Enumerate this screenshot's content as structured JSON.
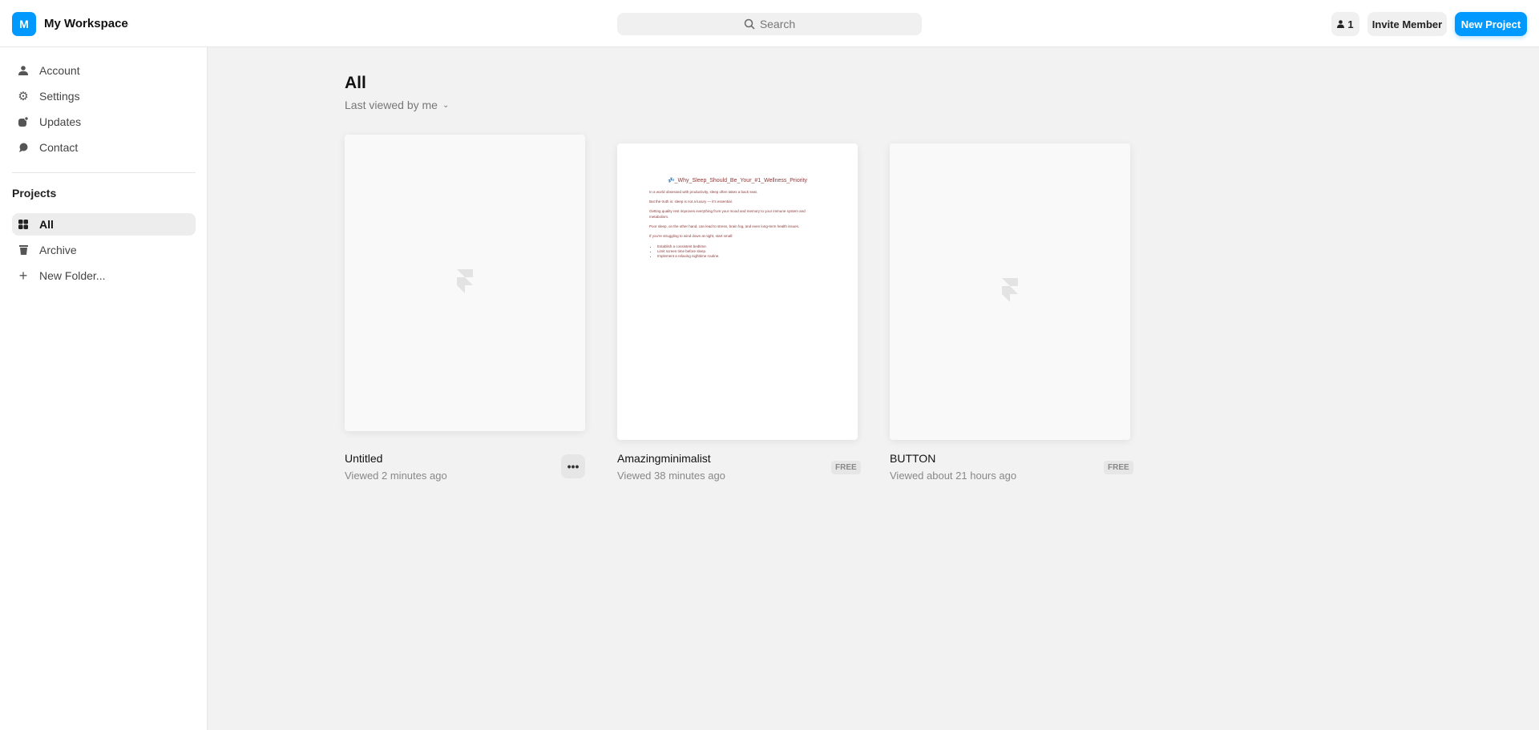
{
  "header": {
    "workspace_initial": "M",
    "workspace_name": "My Workspace",
    "search_placeholder": "Search",
    "member_count": "1",
    "invite_label": "Invite Member",
    "new_project_label": "New Project",
    "accent": "#0099ff"
  },
  "sidebar": {
    "items": [
      {
        "label": "Account",
        "icon": "user-icon"
      },
      {
        "label": "Settings",
        "icon": "gear-icon"
      },
      {
        "label": "Updates",
        "icon": "updates-icon"
      },
      {
        "label": "Contact",
        "icon": "chat-icon"
      }
    ],
    "projects_heading": "Projects",
    "projects": [
      {
        "label": "All",
        "icon": "grid-icon",
        "active": true
      },
      {
        "label": "Archive",
        "icon": "trash-icon"
      },
      {
        "label": "New Folder...",
        "icon": "plus-icon"
      }
    ]
  },
  "main": {
    "title": "All",
    "sort_label": "Last viewed by me",
    "cards": [
      {
        "title": "Untitled",
        "subtitle": "Viewed 2 minutes ago",
        "more": "•••"
      },
      {
        "title": "Amazingminimalist",
        "subtitle": "Viewed 38 minutes ago",
        "badge": "FREE",
        "preview": {
          "heading": "💤_Why_Sleep_Should_Be_Your_#1_Wellness_Priority",
          "paragraphs": [
            "In a world obsessed with productivity, sleep often takes a back seat.",
            "But the truth is: sleep is not a luxury — it's essential.",
            "Getting quality rest improves everything from your mood and memory to your immune system and metabolism.",
            "Poor sleep, on the other hand, can lead to stress, brain fog, and even long-term health issues.",
            "If you're struggling to wind down at night, start small:"
          ],
          "bullets": [
            "Establish a consistent bedtime.",
            "Limit screen time before sleep.",
            "Implement a relaxing nighttime routine."
          ]
        }
      },
      {
        "title": "BUTTON",
        "subtitle": "Viewed about 21 hours ago",
        "badge": "FREE"
      }
    ]
  }
}
